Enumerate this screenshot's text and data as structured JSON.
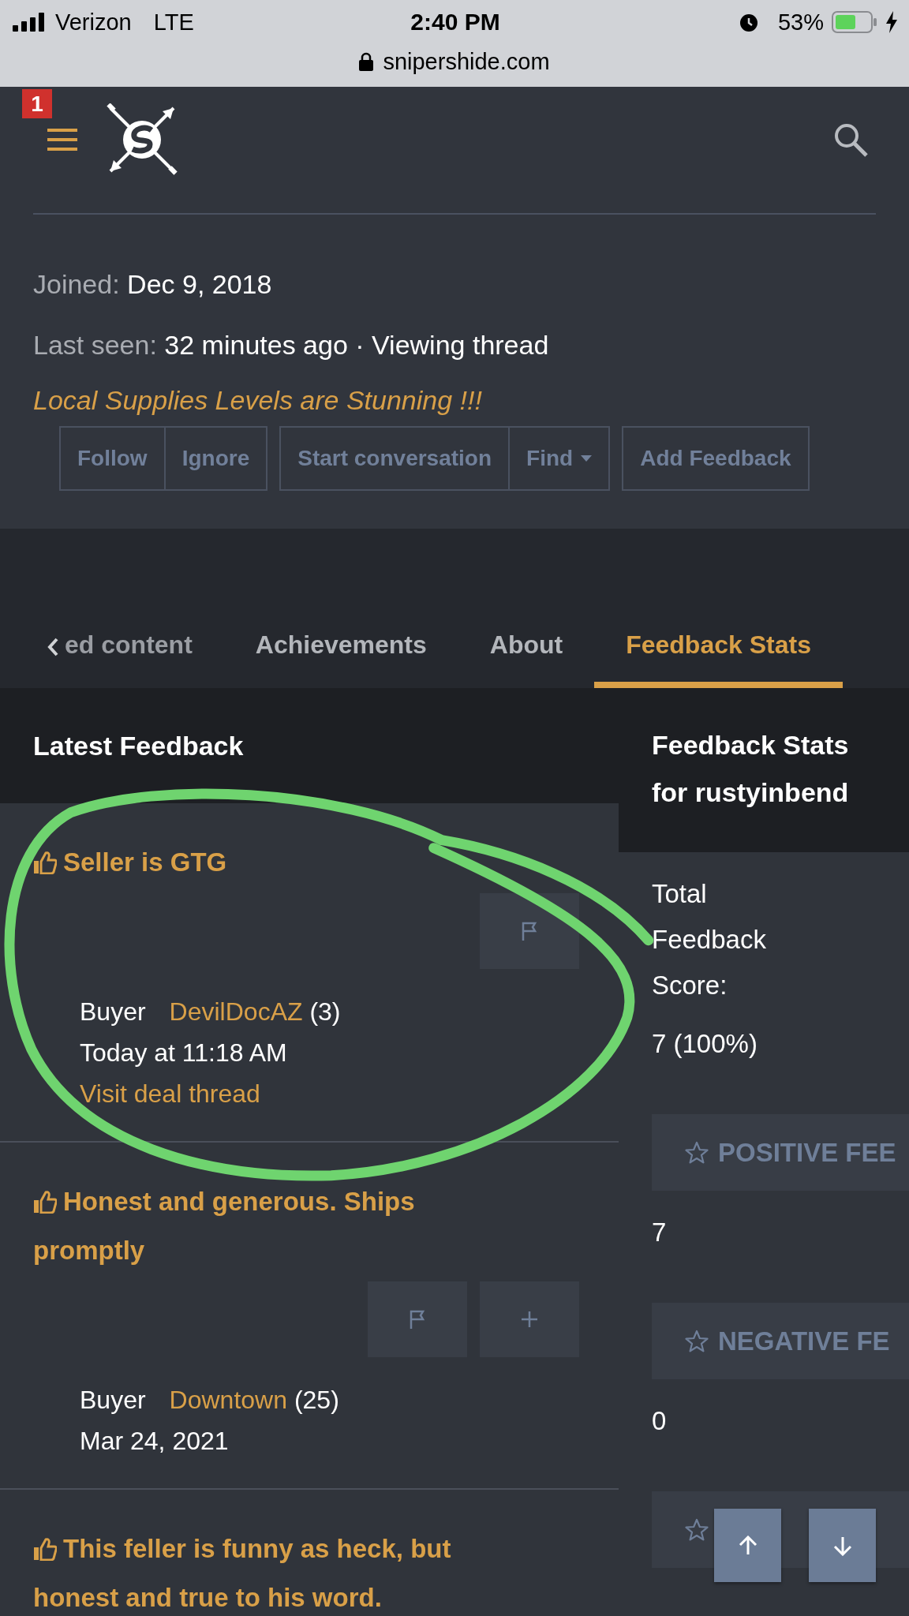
{
  "status_bar": {
    "carrier": "Verizon",
    "network": "LTE",
    "time": "2:40 PM",
    "battery": "53%"
  },
  "address_bar": {
    "url": "snipershide.com"
  },
  "header": {
    "notification_count": "1"
  },
  "profile": {
    "joined_label": "Joined:",
    "joined": "Dec 9, 2018",
    "last_seen_label": "Last seen:",
    "last_seen": "32 minutes ago · Viewing thread",
    "thread_link": "Local Supplies Levels are Stunning !!!",
    "button_groups": [
      [
        {
          "label": "Follow",
          "dropdown": false
        },
        {
          "label": "Ignore",
          "dropdown": false
        }
      ],
      [
        {
          "label": "Start conversation",
          "dropdown": false
        },
        {
          "label": "Find",
          "dropdown": true
        }
      ],
      [
        {
          "label": "Add Feedback",
          "dropdown": false
        }
      ]
    ]
  },
  "tabs": [
    {
      "label": "ed content",
      "selected": false
    },
    {
      "label": "Achievements",
      "selected": false
    },
    {
      "label": "About",
      "selected": false
    },
    {
      "label": "Feedback Stats",
      "selected": true
    }
  ],
  "latest_feedback": {
    "title": "Latest Feedback",
    "items": [
      {
        "title": "Seller is GTG",
        "actions": [
          {
            "kind": "flag"
          }
        ],
        "role": "Buyer",
        "user": "DevilDocAZ",
        "user_count": "(3)",
        "date": "Today at 11:18 AM",
        "link": "Visit deal thread"
      },
      {
        "title": "Honest and generous. Ships promptly",
        "actions": [
          {
            "kind": "flag"
          },
          {
            "kind": "plus"
          }
        ],
        "role": "Buyer",
        "user": "Downtown",
        "user_count": "(25)",
        "date": "Mar 24, 2021"
      },
      {
        "title": "This feller is funny as heck, but honest and true to his word."
      }
    ]
  },
  "feedback_stats": {
    "title": "Feedback Stats for rustyinbend",
    "total_label": "Total Feedback Score:",
    "total": "7 (100%)",
    "categories": [
      {
        "kind": "shown",
        "label": "POSITIVE FEE",
        "value": "7"
      },
      {
        "kind": "shown",
        "label": "NEGATIVE FE",
        "value": "0"
      },
      {
        "kind": "partly-hidden"
      }
    ]
  },
  "scroll_buttons": [
    {
      "kind": "up"
    },
    {
      "kind": "down"
    }
  ]
}
